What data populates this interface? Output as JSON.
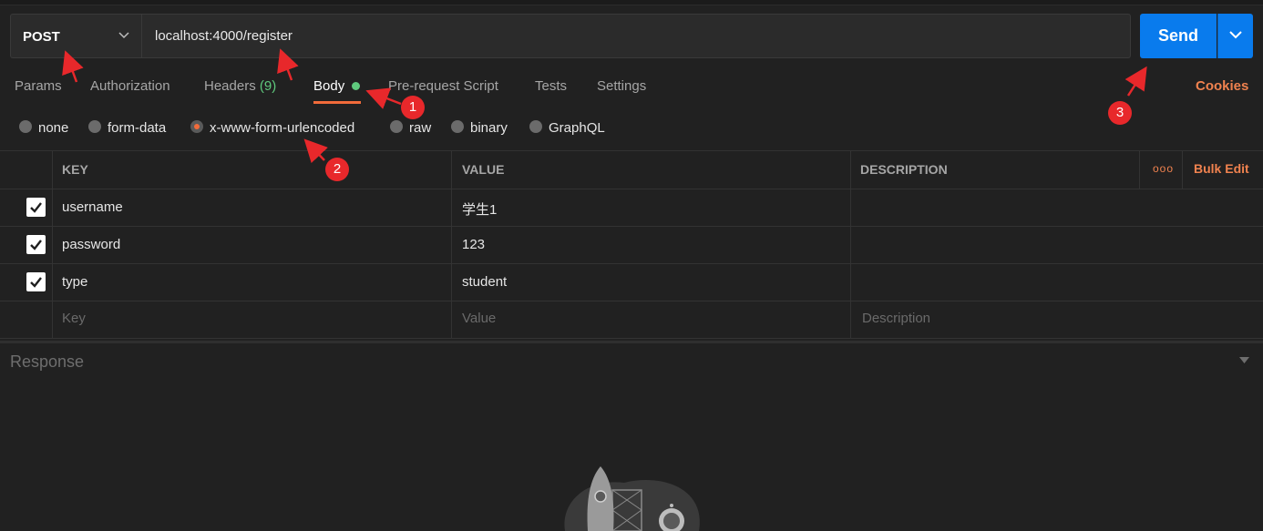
{
  "request": {
    "method": "POST",
    "url": "localhost:4000/register",
    "send_label": "Send"
  },
  "tabs": [
    {
      "label": "Params"
    },
    {
      "label": "Authorization"
    },
    {
      "label": "Headers",
      "count": "(9)"
    },
    {
      "label": "Body",
      "active": true
    },
    {
      "label": "Pre-request Script"
    },
    {
      "label": "Tests"
    },
    {
      "label": "Settings"
    }
  ],
  "cookies_label": "Cookies",
  "body_types": [
    {
      "label": "none"
    },
    {
      "label": "form-data"
    },
    {
      "label": "x-www-form-urlencoded",
      "selected": true
    },
    {
      "label": "raw"
    },
    {
      "label": "binary"
    },
    {
      "label": "GraphQL"
    }
  ],
  "table": {
    "headers": {
      "key": "KEY",
      "value": "VALUE",
      "description": "DESCRIPTION"
    },
    "more_label": "ooo",
    "bulk_edit_label": "Bulk Edit",
    "rows": [
      {
        "key": "username",
        "value": "学生1",
        "checked": true
      },
      {
        "key": "password",
        "value": "123",
        "checked": true
      },
      {
        "key": "type",
        "value": "student",
        "checked": true
      }
    ],
    "placeholders": {
      "key": "Key",
      "value": "Value",
      "description": "Description"
    }
  },
  "annotations": [
    "1",
    "2",
    "3"
  ],
  "response_label": "Response",
  "colors": {
    "accent": "#f26b3a",
    "send": "#097bed",
    "annotation": "#e8282b",
    "status_dot": "#5fc97d"
  }
}
